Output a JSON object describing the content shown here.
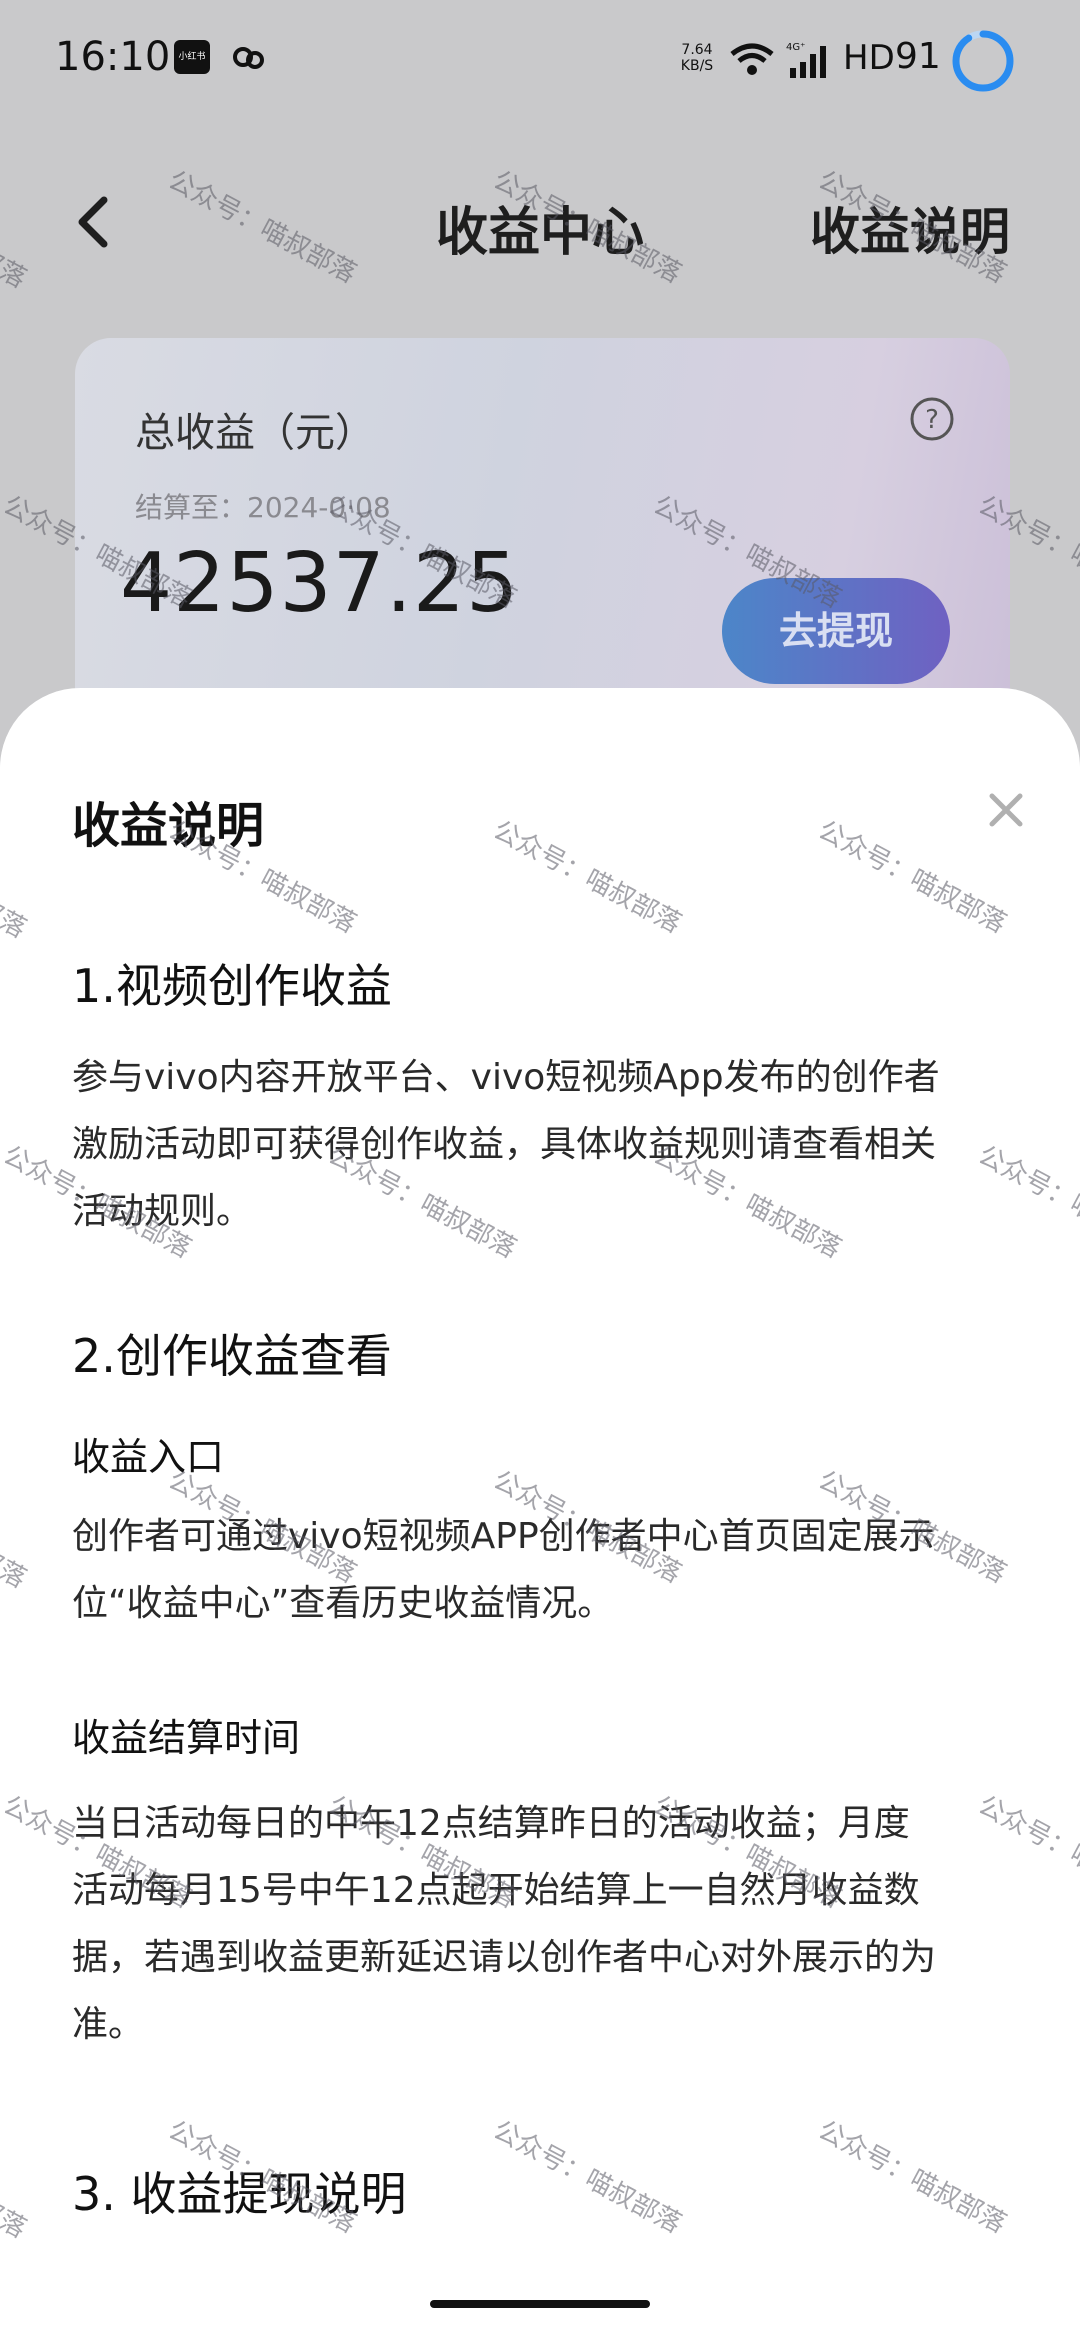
{
  "status_bar": {
    "time": "16:10",
    "notification_app": "小红书",
    "net_speed_value": "7.64",
    "net_speed_unit": "KB/S",
    "network_type": "4G⁺",
    "hd": "HD",
    "battery": "91",
    "battery_level_fraction": 0.91
  },
  "nav": {
    "title": "收益中心",
    "explain_label": "收益说明"
  },
  "earnings_card": {
    "title": "总收益（元）",
    "settle_date": "结算至：2024-0·08",
    "amount": "42537.25",
    "withdraw_label": "去提现"
  },
  "sheet": {
    "title": "收益说明",
    "sections": [
      {
        "heading": "1.视频创作收益",
        "lines": [
          "参与vivo内容开放平台、vivo短视频App发布的创作者",
          "激励活动即可获得创作收益，具体收益规则请查看相关",
          "活动规则。"
        ]
      },
      {
        "heading": "2.创作收益查看",
        "subsections": [
          {
            "subheading": "收益入口",
            "lines": [
              "创作者可通过vivo短视频APP创作者中心首页固定展示",
              "位“收益中心”查看历史收益情况。"
            ]
          },
          {
            "subheading": "收益结算时间",
            "lines": [
              "当日活动每日的中午12点结算昨日的活动收益；月度",
              "活动每月15号中午12点起开始结算上一自然月收益数",
              "据，若遇到收益更新延迟请以创作者中心对外展示的为",
              "准。"
            ]
          }
        ]
      },
      {
        "heading": "3. 收益提现说明"
      }
    ]
  },
  "watermark_text": "公众号：喵叔部落",
  "colors": {
    "accent_ring": "#2a8cf0",
    "withdraw_start": "#4c86c9",
    "withdraw_end": "#6f61c2"
  }
}
